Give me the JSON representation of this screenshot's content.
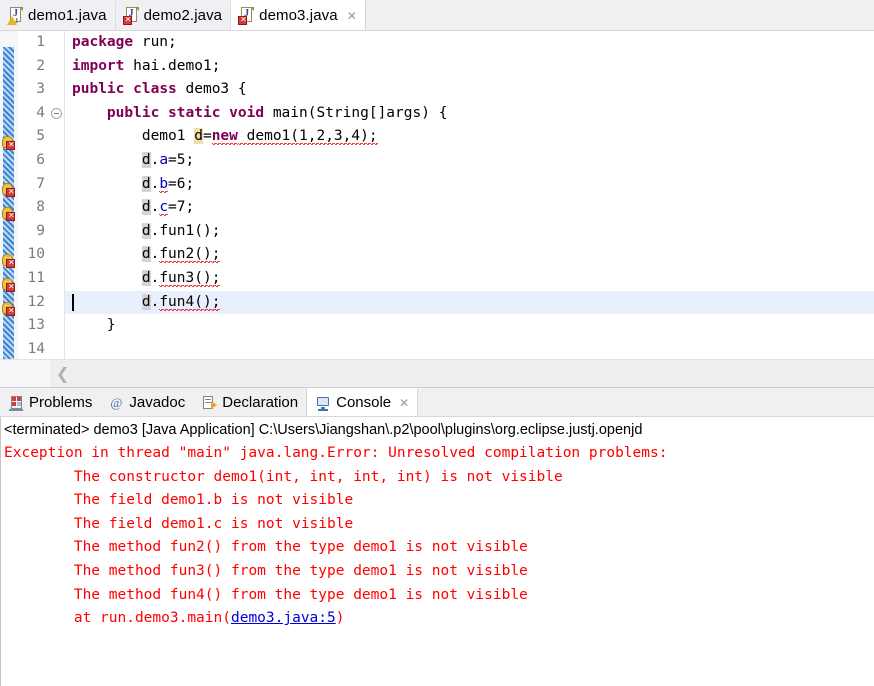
{
  "editor_tabs": [
    {
      "label": "demo1.java",
      "icon": "java-file-warning-icon",
      "active": false,
      "closable": false,
      "badge": "warn"
    },
    {
      "label": "demo2.java",
      "icon": "java-file-error-icon",
      "active": false,
      "closable": false,
      "badge": "err"
    },
    {
      "label": "demo3.java",
      "icon": "java-file-error-icon",
      "active": true,
      "closable": true,
      "badge": "err",
      "close_glyph": "✕"
    }
  ],
  "code": {
    "lines": [
      {
        "num": "1",
        "error": false,
        "fold": false,
        "current": false
      },
      {
        "num": "2",
        "error": false,
        "fold": false,
        "current": false
      },
      {
        "num": "3",
        "error": false,
        "fold": false,
        "current": false
      },
      {
        "num": "4",
        "error": false,
        "fold": true,
        "current": false
      },
      {
        "num": "5",
        "error": true,
        "fold": false,
        "current": false
      },
      {
        "num": "6",
        "error": false,
        "fold": false,
        "current": false
      },
      {
        "num": "7",
        "error": true,
        "fold": false,
        "current": false
      },
      {
        "num": "8",
        "error": true,
        "fold": false,
        "current": false
      },
      {
        "num": "9",
        "error": false,
        "fold": false,
        "current": false
      },
      {
        "num": "10",
        "error": true,
        "fold": false,
        "current": false
      },
      {
        "num": "11",
        "error": true,
        "fold": false,
        "current": false
      },
      {
        "num": "12",
        "error": true,
        "fold": false,
        "current": true
      },
      {
        "num": "13",
        "error": false,
        "fold": false,
        "current": false
      },
      {
        "num": "14",
        "error": false,
        "fold": false,
        "current": false
      }
    ],
    "text": {
      "l1_kw": "package",
      "l1_rest": " run;",
      "l2_kw": "import",
      "l2_rest": " hai.demo1;",
      "l3_kw1": "public",
      "l3_kw2": "class",
      "l3_name": " demo3 {",
      "l4_indent": "    ",
      "l4_kw1": "public",
      "l4_kw2": "static",
      "l4_kw3": "void",
      "l4_rest": " main(String[]args) {",
      "l5_indent": "        ",
      "l5_type": "demo1 ",
      "l5_var": "d",
      "l5_eq": "=",
      "l5_kw": "new",
      "l5_call": " demo1(1,2,3,4);",
      "l6_indent": "        ",
      "l6_var": "d",
      "l6_dot": ".",
      "l6_field": "a",
      "l6_rest": "=5;",
      "l7_indent": "        ",
      "l7_var": "d",
      "l7_dot": ".",
      "l7_field": "b",
      "l7_rest": "=6;",
      "l8_indent": "        ",
      "l8_var": "d",
      "l8_dot": ".",
      "l8_field": "c",
      "l8_rest": "=7;",
      "l9_indent": "        ",
      "l9_var": "d",
      "l9_dot": ".",
      "l9_call": "fun1();",
      "l10_indent": "        ",
      "l10_var": "d",
      "l10_dot": ".",
      "l10_call": "fun2();",
      "l11_indent": "        ",
      "l11_var": "d",
      "l11_dot": ".",
      "l11_call": "fun3();",
      "l12_indent": "        ",
      "l12_var": "d",
      "l12_dot": ".",
      "l12_call": "fun4();",
      "l13": "    }",
      "l14": ""
    }
  },
  "editor_scroll": {
    "left_arrow": "❮"
  },
  "panel_tabs": [
    {
      "label": "Problems",
      "icon": "problems-icon",
      "active": false,
      "closable": false
    },
    {
      "label": "Javadoc",
      "icon": "javadoc-at-icon",
      "active": false,
      "closable": false,
      "glyph": "@"
    },
    {
      "label": "Declaration",
      "icon": "declaration-icon",
      "active": false,
      "closable": false
    },
    {
      "label": "Console",
      "icon": "console-monitor-icon",
      "active": true,
      "closable": true,
      "close_glyph": "✕"
    }
  ],
  "console": {
    "header": "<terminated> demo3 [Java Application] C:\\Users\\Jiangshan\\.p2\\pool\\plugins\\org.eclipse.justj.openjd",
    "lines": [
      "Exception in thread \"main\" java.lang.Error: Unresolved compilation problems: ",
      "\tThe constructor demo1(int, int, int, int) is not visible",
      "\tThe field demo1.b is not visible",
      "\tThe field demo1.c is not visible",
      "\tThe method fun2() from the type demo1 is not visible",
      "\tThe method fun3() from the type demo1 is not visible",
      "\tThe method fun4() from the type demo1 is not visible",
      ""
    ],
    "trace_prefix": "\tat run.demo3.main(",
    "trace_link": "demo3.java:5",
    "trace_suffix": ")"
  },
  "colors": {
    "keyword": "#7f0055",
    "field": "#0000c0",
    "error_text": "#ff0000",
    "link": "#0000dd",
    "current_line": "#e8f0fd",
    "occurrence": "#d4d4d4",
    "write_occurrence": "#f2dcaa"
  }
}
